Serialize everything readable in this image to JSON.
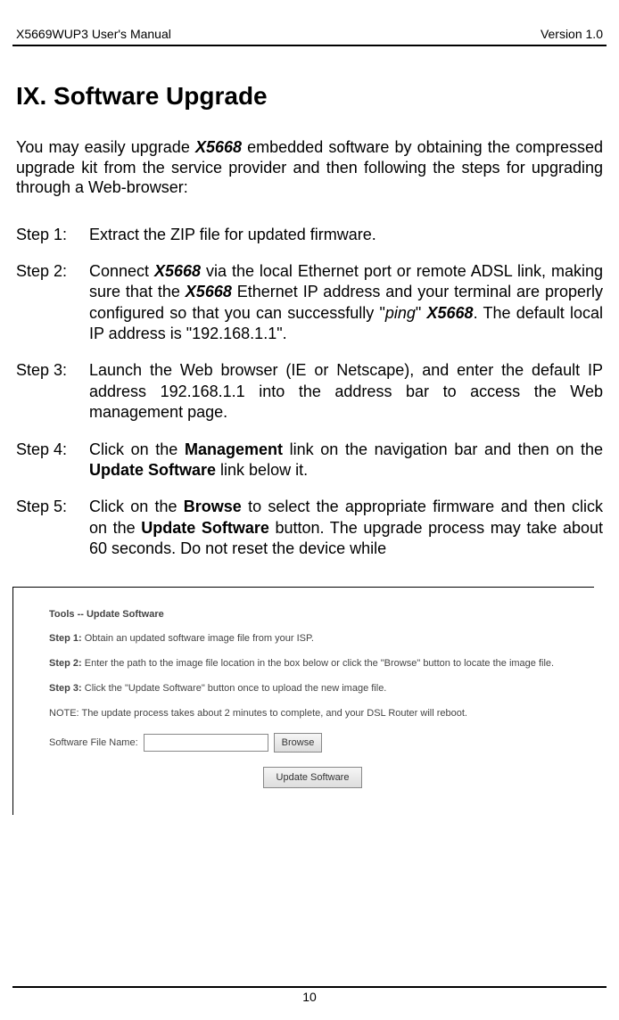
{
  "header": {
    "left": "X5669WUP3 User's Manual",
    "right": "Version 1.0"
  },
  "title": "IX. Software Upgrade",
  "intro": {
    "pre": "You may easily upgrade ",
    "bold1": "X5668",
    "post": " embedded software by obtaining the compressed upgrade kit from the service provider and then following the steps for upgrading through a Web-browser:"
  },
  "steps": [
    {
      "label": "Step 1:",
      "plain": "Extract the ZIP file for updated firmware."
    },
    {
      "label": "Step 2:",
      "parts": {
        "t0": "Connect ",
        "b0": "X5668",
        "t1": " via the local Ethernet port or remote ADSL link, making sure that the ",
        "b1": "X5668",
        "t2": " Ethernet IP address and your terminal are properly configured so that you can successfully \"",
        "i0": "ping",
        "t3": "\" ",
        "b2": "X5668",
        "t4": ". The default local IP address is \"192.168.1.1\"."
      }
    },
    {
      "label": "Step 3:",
      "plain": "Launch the Web browser (IE or Netscape), and enter the default IP address 192.168.1.1 into the address bar to access the Web management page."
    },
    {
      "label": "Step 4:",
      "parts": {
        "t0": "Click on the ",
        "b0": "Management",
        "t1": " link on the navigation bar and then on the ",
        "b1": "Update Software",
        "t2": " link below it."
      }
    },
    {
      "label": "Step 5:",
      "parts": {
        "t0": "Click on the ",
        "b0": "Browse",
        "t1": " to select the appropriate firmware and then click on the ",
        "b1": "Update Software",
        "t2": " button.   The upgrade process may take about 60 seconds. Do not reset the device while"
      }
    }
  ],
  "screenshot": {
    "title": "Tools -- Update Software",
    "s1_label": "Step 1:",
    "s1_text": " Obtain an updated software image file from your ISP.",
    "s2_label": "Step 2:",
    "s2_text": " Enter the path to the image file location in the box below or click the \"Browse\" button to locate the image file.",
    "s3_label": "Step 3:",
    "s3_text": " Click the \"Update Software\" button once to upload the new image file.",
    "note": "NOTE: The update process takes about 2 minutes to complete, and your DSL Router will reboot.",
    "file_label": "Software File Name:",
    "file_value": "",
    "browse_btn": "Browse",
    "update_btn": "Update Software"
  },
  "footer": {
    "page": "10"
  }
}
